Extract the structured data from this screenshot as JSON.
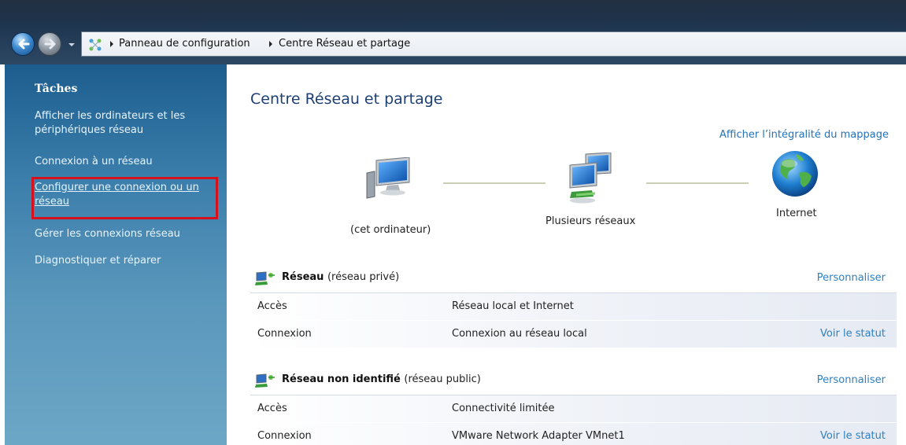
{
  "address_bar": {
    "crumbs": [
      "Panneau de configuration",
      "Centre Réseau et partage"
    ]
  },
  "sidebar": {
    "title": "Tâches",
    "tasks": [
      "Afficher les ordinateurs et les périphériques réseau",
      "Connexion à un réseau",
      "Configurer une connexion ou un réseau",
      "Gérer les connexions réseau",
      "Diagnostiquer et réparer"
    ]
  },
  "main": {
    "title": "Centre Réseau et partage",
    "full_map_link": "Afficher l’intégralité du mappage",
    "map": {
      "this_computer": "(cet ordinateur)",
      "multiple_networks": "Plusieurs réseaux",
      "internet": "Internet"
    },
    "networks": [
      {
        "name": "Réseau",
        "type": "(réseau privé)",
        "customize": "Personnaliser",
        "rows": [
          {
            "label": "Accès",
            "value": "Réseau local et Internet",
            "link": ""
          },
          {
            "label": "Connexion",
            "value": "Connexion au réseau local",
            "link": "Voir le statut"
          }
        ]
      },
      {
        "name": "Réseau non identifié",
        "type": "(réseau public)",
        "customize": "Personnaliser",
        "rows": [
          {
            "label": "Accès",
            "value": "Connectivité limitée",
            "link": ""
          },
          {
            "label": "Connexion",
            "value": "VMware Network Adapter VMnet1",
            "link": "Voir le statut"
          }
        ]
      }
    ]
  },
  "colors": {
    "highlight_box": "#d4111c",
    "link": "#2f80c0",
    "title": "#1e3f73"
  },
  "icons": {
    "back": "back-arrow-icon",
    "forward": "forward-arrow-icon",
    "address": "network-center-icon",
    "this_computer": "computer-icon",
    "multiple_networks": "multiple-networks-icon",
    "internet": "globe-icon",
    "network": "network-icon"
  }
}
